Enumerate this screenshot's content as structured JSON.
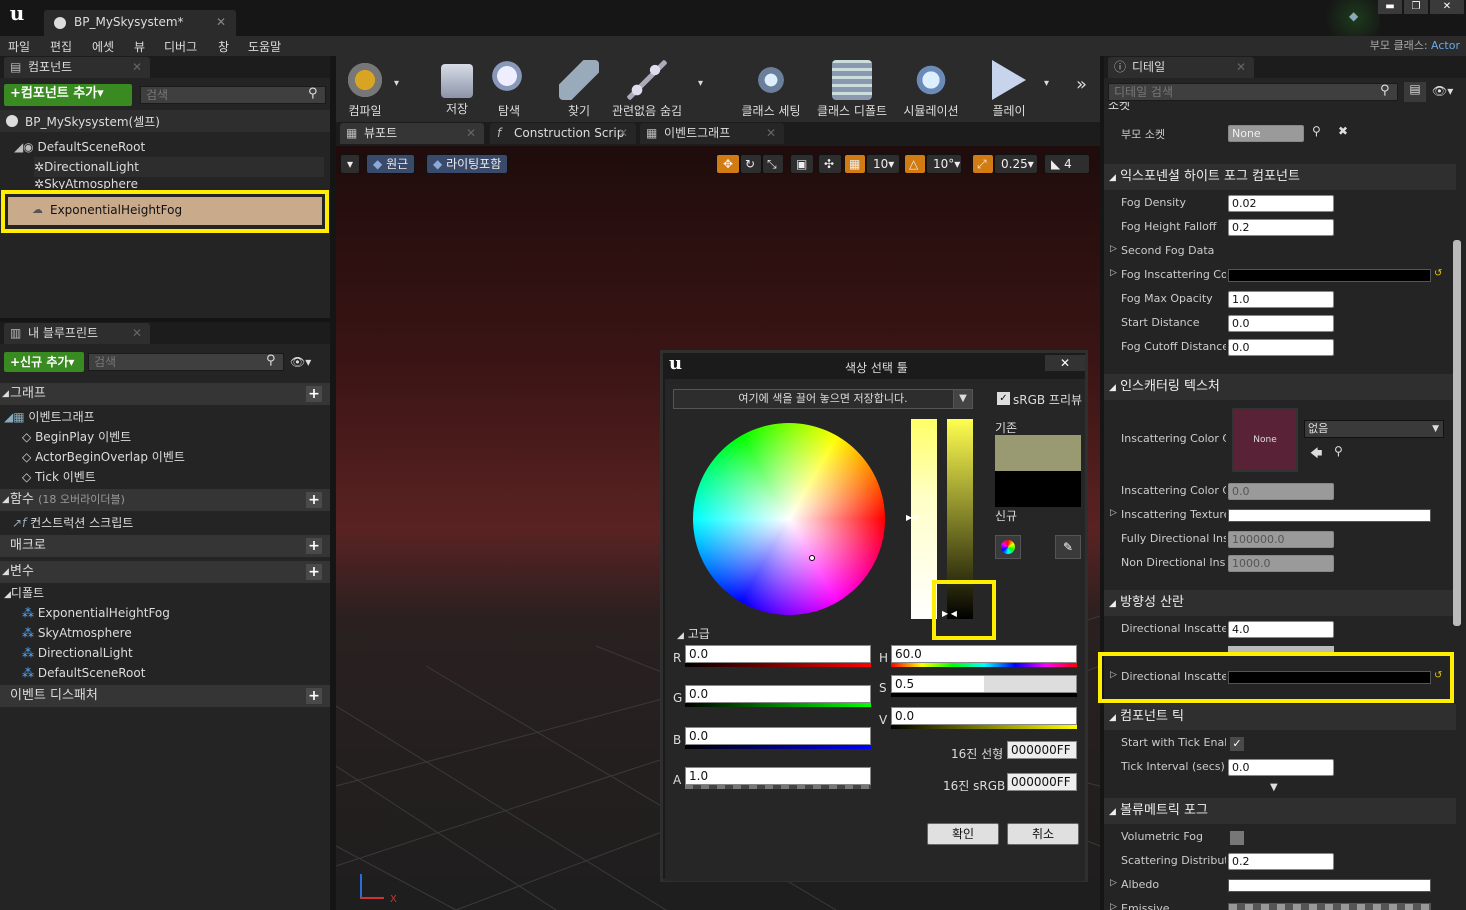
{
  "window": {
    "tab_title": "BP_MySkysystem*",
    "min": "▬",
    "max": "❐",
    "close": "✕"
  },
  "menu": [
    "파일",
    "편집",
    "에셋",
    "뷰",
    "디버그",
    "창",
    "도움말"
  ],
  "parent_class": {
    "label": "부모 클래스:",
    "value": "Actor"
  },
  "components": {
    "tab": "컴포넌트",
    "add_button": "+컴포넌트 추가▾",
    "search_placeholder": "검색",
    "self_item": "BP_MySkysystem(셀프)",
    "items": [
      "DefaultSceneRoot",
      "DirectionalLight",
      "SkyAtmosphere",
      "ExponentialHeightFog"
    ]
  },
  "my_blueprint": {
    "tab": "내 블루프린트",
    "add_button": "+신규 추가▾",
    "search_placeholder": "검색",
    "graph": "그래프",
    "event_graph": "이벤트그래프",
    "events": [
      "BeginPlay 이벤트",
      "ActorBeginOverlap 이벤트",
      "Tick 이벤트"
    ],
    "functions": "함수",
    "functions_note": "(18 오버라이더블)",
    "construction": "컨스트럭션 스크립트",
    "macros": "매크로",
    "variables": "변수",
    "defaults": "디폴트",
    "default_items": [
      "ExponentialHeightFog",
      "SkyAtmosphere",
      "DirectionalLight",
      "DefaultSceneRoot"
    ],
    "dispatchers": "이벤트 디스패처"
  },
  "toolbar": [
    "컴파일",
    "저장",
    "탐색",
    "찾기",
    "관련없음 숨김",
    "클래스 세팅",
    "클래스 디폴트",
    "시뮬레이션",
    "플레이"
  ],
  "editor_tabs": [
    "뷰포트",
    "Construction Scrip",
    "이벤트그래프"
  ],
  "viewport": {
    "perspective": "원근",
    "lighting": "라이팅포함",
    "grid": "10",
    "rot": "10°",
    "scale": "0.25",
    "camspeed": "4",
    "axis_x": "X"
  },
  "details": {
    "tab": "디테일",
    "search_placeholder": "디테일 검색",
    "socket_header": "소켓",
    "parent_socket_label": "부모 소켓",
    "parent_socket_value": "None",
    "fog_header": "익스포넨셜 하이트 포그 컴포넌트",
    "fog_rows": [
      {
        "label": "Fog Density",
        "value": "0.02"
      },
      {
        "label": "Fog Height Falloff",
        "value": "0.2"
      },
      {
        "label": "Second Fog Data",
        "value": ""
      },
      {
        "label": "Fog Inscattering Colo",
        "value": ""
      },
      {
        "label": "Fog Max Opacity",
        "value": "1.0"
      },
      {
        "label": "Start Distance",
        "value": "0.0"
      },
      {
        "label": "Fog Cutoff Distance",
        "value": "0.0"
      }
    ],
    "inscatter_header": "인스캐터링 텍스처",
    "inscatter_cube_label": "Inscattering Color Cu",
    "thumb_text": "None",
    "asset_value": "없음",
    "inscatter_rows": [
      {
        "label": "Inscattering Color Cu",
        "value": "0.0"
      },
      {
        "label": "Inscattering Texture",
        "value": ""
      },
      {
        "label": "Fully Directional Insc",
        "value": "100000.0"
      },
      {
        "label": "Non Directional Insca",
        "value": "1000.0"
      }
    ],
    "dir_header": "방향성 산란",
    "dir_rows": [
      {
        "label": "Directional Inscatteri",
        "value": "4.0"
      },
      {
        "label": "Directional Inscatter",
        "value": ""
      }
    ],
    "tick_header": "컴포넌트 틱",
    "tick_rows": [
      {
        "label": "Start with Tick Enabl",
        "value": ""
      },
      {
        "label": "Tick Interval (secs)",
        "value": "0.0"
      }
    ],
    "vol_header": "볼류메트릭 포그",
    "vol_rows": [
      {
        "label": "Volumetric Fog",
        "value": ""
      },
      {
        "label": "Scattering Distributi",
        "value": "0.2"
      },
      {
        "label": "Albedo",
        "value": ""
      },
      {
        "label": "Emissive",
        "value": ""
      }
    ]
  },
  "color_picker": {
    "title": "색상 선택 툴",
    "theme_drop": "여기에 색을 끌어 놓으면 저장합니다.",
    "srgb": "sRGB 프리뷰",
    "old_label": "기존",
    "new_label": "신규",
    "advanced": "고급",
    "R": "0.0",
    "G": "0.0",
    "B": "0.0",
    "A": "1.0",
    "H": "60.0",
    "S": "0.5",
    "V": "0.0",
    "hex_linear_label": "16진 선형",
    "hex_linear": "000000FF",
    "hex_srgb_label": "16진 sRGB",
    "hex_srgb": "000000FF",
    "ok": "확인",
    "cancel": "취소",
    "old_color": "#9a9a72",
    "new_color": "#000000"
  }
}
